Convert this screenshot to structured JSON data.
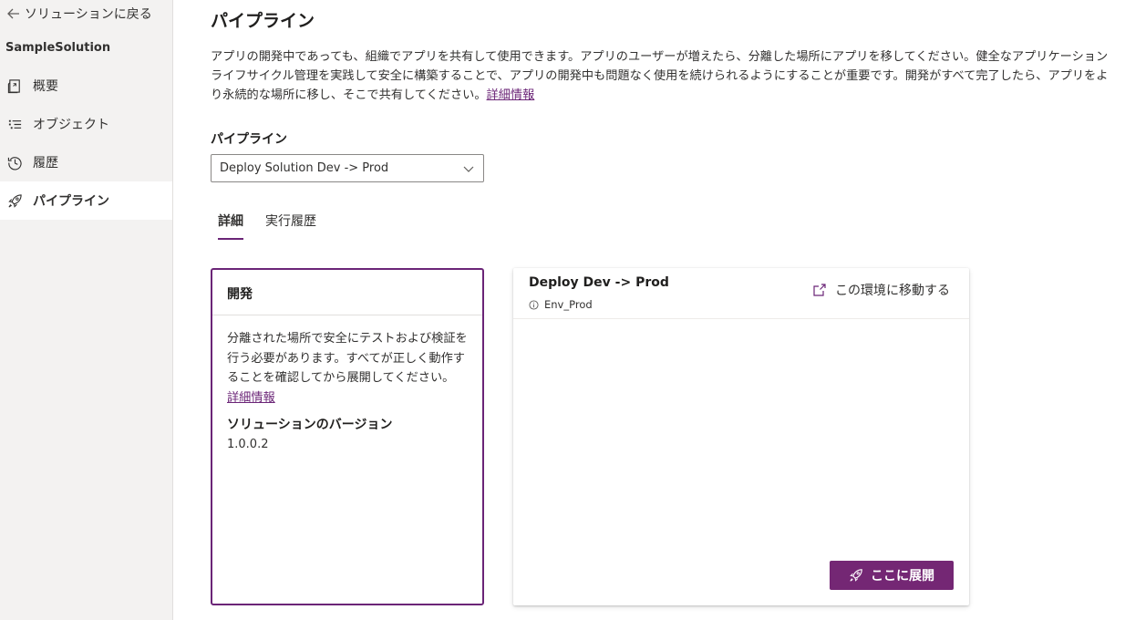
{
  "sidebar": {
    "back_label": "ソリューションに戻る",
    "solution_name": "SampleSolution",
    "items": [
      {
        "label": "概要",
        "icon": "overview-icon"
      },
      {
        "label": "オブジェクト",
        "icon": "objects-list-icon"
      },
      {
        "label": "履歴",
        "icon": "history-icon"
      },
      {
        "label": "パイプライン",
        "icon": "rocket-icon",
        "active": true
      }
    ]
  },
  "main": {
    "title": "パイプライン",
    "description": "アプリの開発中であっても、組織でアプリを共有して使用できます。アプリのユーザーが増えたら、分離した場所にアプリを移してください。健全なアプリケーション ライフサイクル管理を実践して安全に構築することで、アプリの開発中も問題なく使用を続けられるようにすることが重要です。開発がすべて完了したら、アプリをより永続的な場所に移し、そこで共有してください。",
    "learn_more": "詳細情報",
    "pipeline_label": "パイプライン",
    "pipeline_selected": "Deploy Solution Dev -> Prod",
    "tabs": [
      {
        "label": "詳細",
        "active": true
      },
      {
        "label": "実行履歴",
        "active": false
      }
    ]
  },
  "stage": {
    "title": "開発",
    "description": "分離された場所で安全にテストおよび検証を行う必要があります。すべてが正しく動作することを確認してから展開してください。",
    "learn_more": "詳細情報",
    "version_label": "ソリューションのバージョン",
    "version_value": "1.0.0.2"
  },
  "deploy": {
    "title": "Deploy Dev -> Prod",
    "environment": "Env_Prod",
    "goto_label": "この環境に移動する",
    "button_label": "ここに展開"
  },
  "colors": {
    "accent": "#6b2577",
    "button": "#742774",
    "sidebar_bg": "#f3f2f1"
  }
}
